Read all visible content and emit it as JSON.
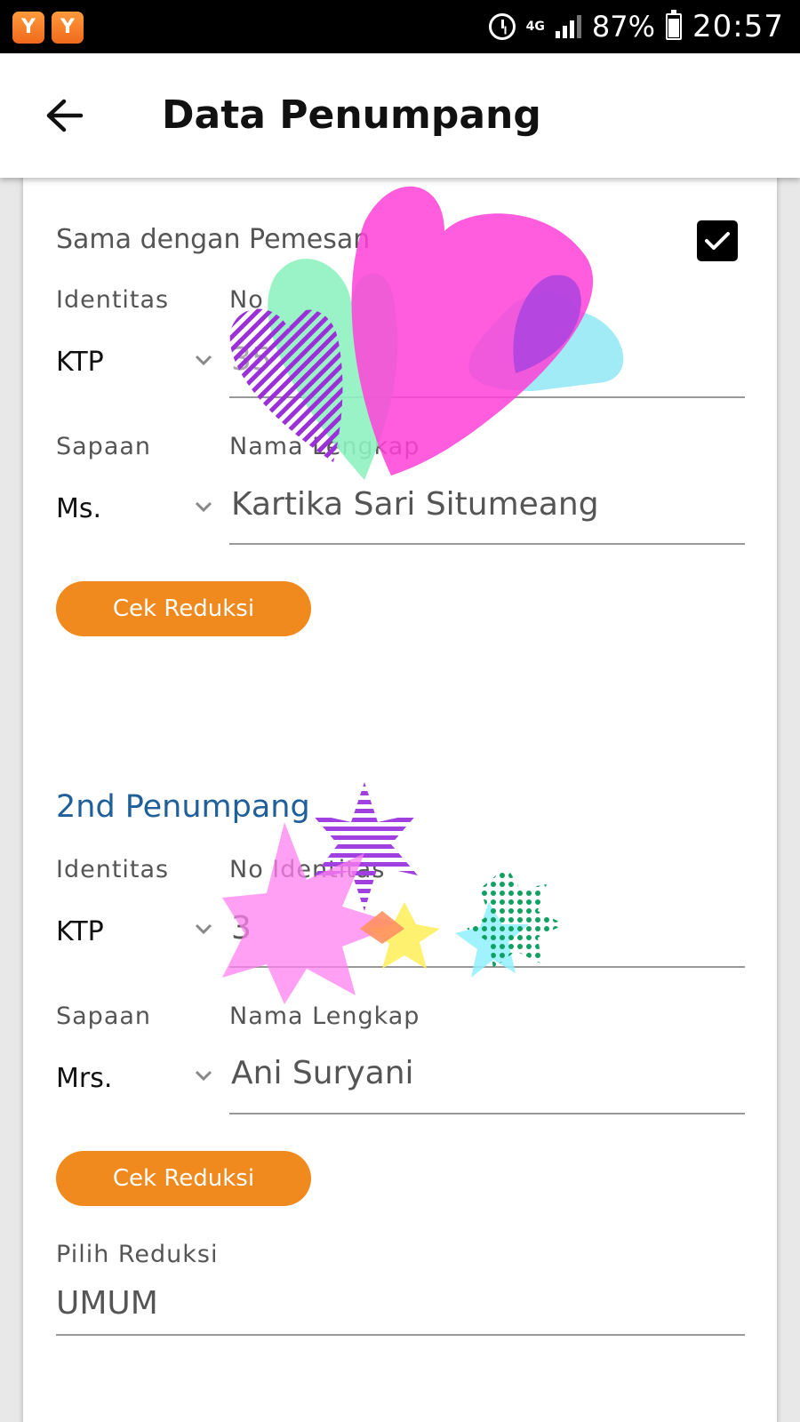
{
  "status_bar": {
    "network": "4G",
    "battery": "87%",
    "time": "20:57"
  },
  "header": {
    "title": "Data Penumpang"
  },
  "passenger1": {
    "same_as_booker_label": "Sama dengan Pemesan",
    "same_as_booker_checked": true,
    "identity_label": "Identitas",
    "identity_value": "KTP",
    "id_number_label": "No",
    "id_number_value": "35",
    "salutation_label": "Sapaan",
    "salutation_value": "Ms.",
    "fullname_label": "Nama Lengkap",
    "fullname_value": "Kartika Sari Situmeang",
    "reduction_button": "Cek Reduksi"
  },
  "passenger2": {
    "section_title": "2nd Penumpang",
    "identity_label": "Identitas",
    "identity_value": "KTP",
    "id_number_label": "No Identitas",
    "id_number_value": "3",
    "salutation_label": "Sapaan",
    "salutation_value": "Mrs.",
    "fullname_label": "Nama Lengkap",
    "fullname_value": "Ani Suryani",
    "reduction_button": "Cek Reduksi",
    "choose_reduction_label": "Pilih Reduksi",
    "choose_reduction_value": "UMUM"
  },
  "colors": {
    "accent_orange": "#f0891e",
    "section_blue": "#1f5f9a"
  }
}
